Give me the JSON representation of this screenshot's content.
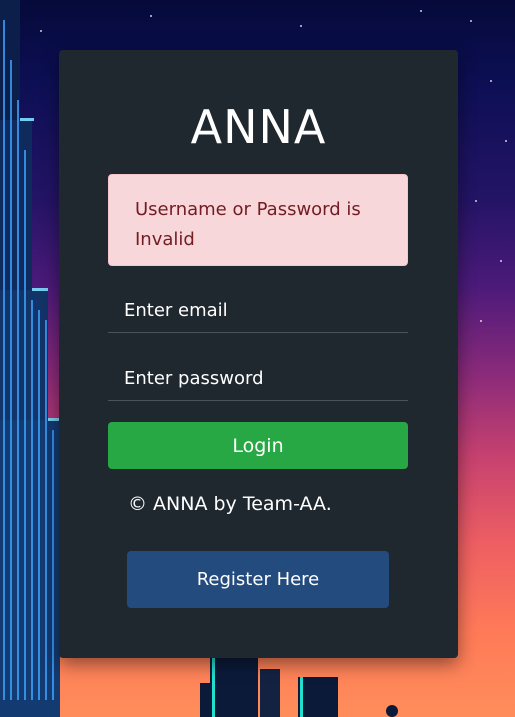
{
  "app": {
    "title": "ANNA"
  },
  "alert": {
    "message": "Username or Password is Invalid"
  },
  "form": {
    "email_placeholder": "Enter email",
    "password_placeholder": "Enter password",
    "login_label": "Login"
  },
  "footer": {
    "copyright": "© ANNA by Team-AA."
  },
  "register": {
    "label": "Register Here"
  },
  "colors": {
    "card_bg": "#1f272f",
    "alert_bg": "#f8d7da",
    "alert_text": "#721c24",
    "login_bg": "#28a745",
    "register_bg": "#234b7d"
  }
}
